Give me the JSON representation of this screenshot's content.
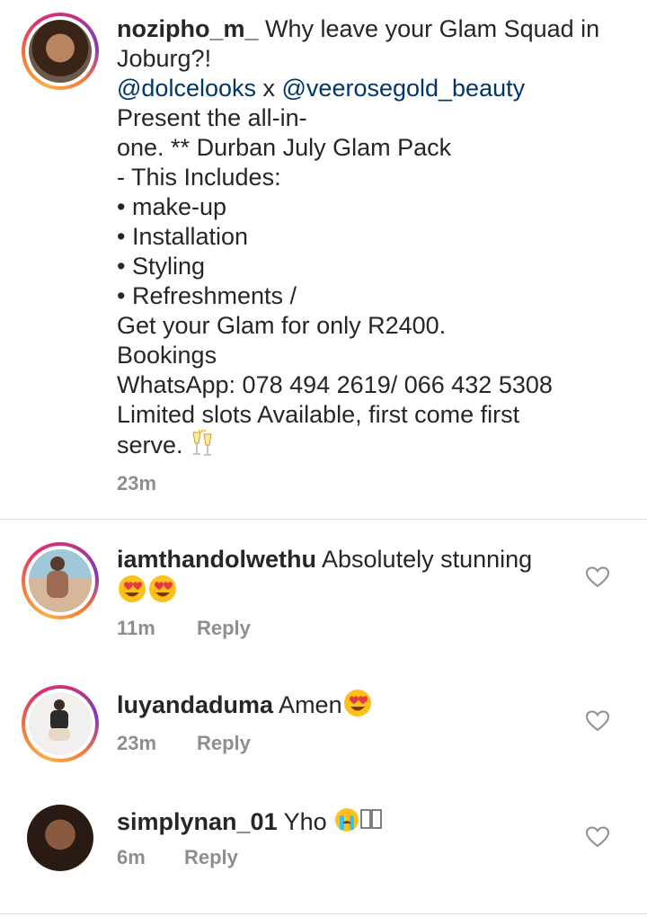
{
  "post": {
    "username": "nozipho_m_",
    "title_line": " Why leave your Glam Squad in Joburg?!",
    "mention1": "@dolcelooks",
    "mention_sep": " x ",
    "mention2": "@veerosegold_beauty",
    "body_lines": "Present the all-in-\none. ** Durban July Glam Pack\n- This Includes:\n• make-up\n• Installation\n• Styling\n• Refreshments /\nGet your Glam for only R2400.\nBookings\nWhatsApp: 078 494 2619/ 066 432 5308\nLimited slots Available, first come first\nserve. ",
    "time": "23m"
  },
  "comments": [
    {
      "username": "iamthandolwethu",
      "text": " Absolutely stunning",
      "time": "11m",
      "reply": "Reply"
    },
    {
      "username": "luyandaduma",
      "text": " Amen",
      "time": "23m",
      "reply": "Reply"
    },
    {
      "username": "simplynan_01",
      "text": " Yho ",
      "time": "6m",
      "reply": "Reply"
    }
  ],
  "icons": {
    "heart": "heart-outline-icon",
    "heart_eyes": "heart-eyes-emoji",
    "crying": "loudly-crying-emoji",
    "cheers": "clinking-glasses-emoji"
  },
  "colors": {
    "mention": "#00376b",
    "meta": "#8e8e8e",
    "divider": "#dbdbdb"
  }
}
